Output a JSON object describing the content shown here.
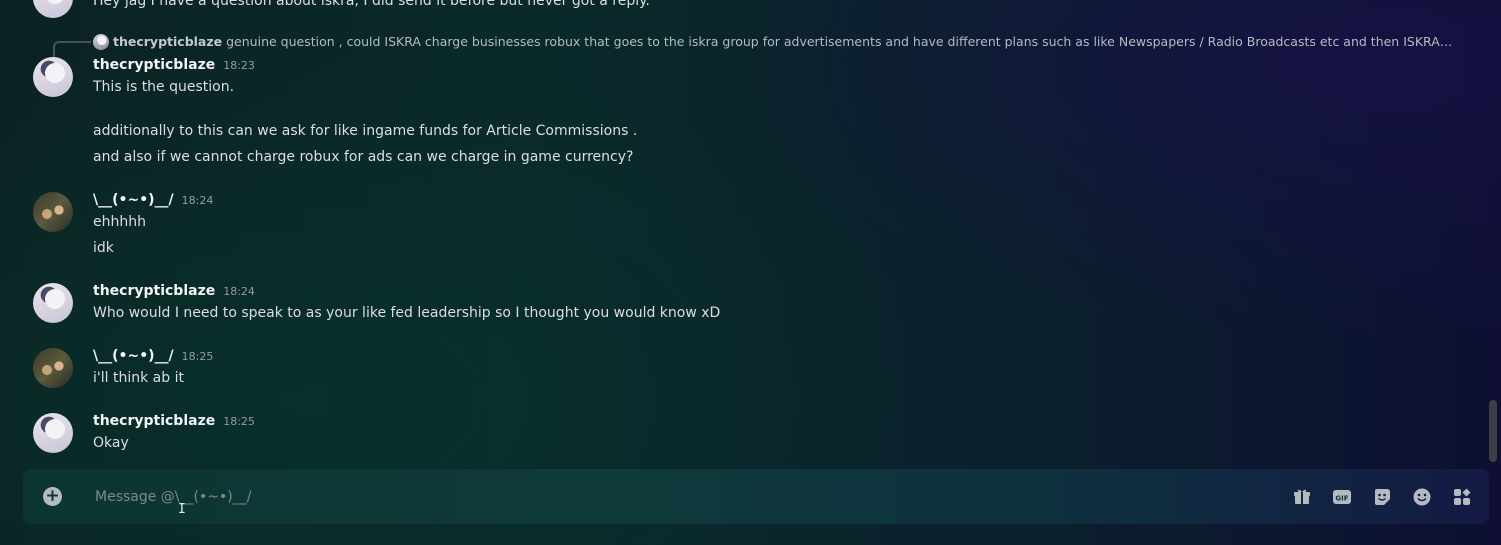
{
  "messages": {
    "top_partial": "Hey jag I have a question about iskra, I did send it before but never got a reply.",
    "reply": {
      "name": "thecrypticblaze",
      "text": "genuine question , could ISKRA charge businesses robux that goes to the iskra group for advertisements and have different plans such as like Newspapers / Radio Broadcasts etc and then ISKRA can use them ..."
    },
    "m1": {
      "user": "thecrypticblaze",
      "time": "18:23",
      "lines": [
        "This is the question.",
        "additionally to this can we ask for like ingame funds for Article Commissions .",
        "and also if we cannot charge robux for ads can we charge in game currency?"
      ]
    },
    "m2": {
      "user": "\\__(•~•)__/",
      "time": "18:24",
      "lines": [
        "ehhhhh",
        "idk"
      ]
    },
    "m3": {
      "user": "thecrypticblaze",
      "time": "18:24",
      "lines": [
        "Who would I need to speak to as your like fed leadership so I thought you would know xD"
      ]
    },
    "m4": {
      "user": "\\__(•~•)__/",
      "time": "18:25",
      "lines": [
        "i'll think ab it"
      ]
    },
    "m5": {
      "user": "thecrypticblaze",
      "time": "18:25",
      "lines": [
        "Okay"
      ]
    }
  },
  "composer": {
    "placeholder": "Message @\\__(•~•)__/",
    "plus_symbol": "+",
    "tools": [
      "gift-icon",
      "gif-icon",
      "sticker-icon",
      "emoji-icon",
      "apps-icon"
    ]
  },
  "colors": {
    "text": "#dbdee1",
    "muted": "#949ba4",
    "icon": "#b5bac1"
  }
}
